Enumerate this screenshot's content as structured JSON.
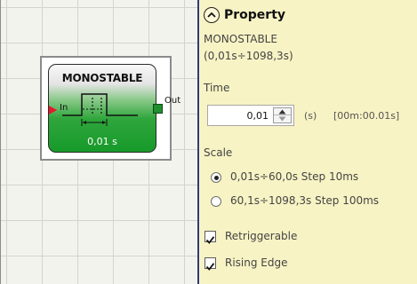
{
  "module": {
    "title": "MONOSTABLE",
    "input_label": "In",
    "output_label": "Out",
    "time_value": "0,01 s"
  },
  "panel": {
    "header": "Property",
    "module_name": "MONOSTABLE",
    "range": "(0,01s÷1098,3s)",
    "time_label": "Time",
    "time_value": "0,01",
    "time_unit": "(s)",
    "time_display": "[00m:00.01s]",
    "scale_label": "Scale",
    "scale_options": [
      {
        "label": "0,01s÷60,0s Step 10ms",
        "selected": true
      },
      {
        "label": "60,1s÷1098,3s Step 100ms",
        "selected": false
      }
    ],
    "checkboxes": [
      {
        "label": "Retriggerable",
        "checked": true
      },
      {
        "label": "Rising Edge",
        "checked": true
      }
    ]
  },
  "colors": {
    "panel_background": "#f7f3c4",
    "module_green": "#179a2a",
    "input_arrow": "#e8172a",
    "divider": "#2a3d7a"
  }
}
